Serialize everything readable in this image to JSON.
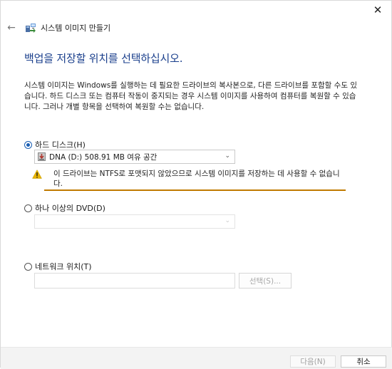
{
  "window": {
    "close_glyph": "✕",
    "back_glyph": "←",
    "title": "시스템 이미지 만들기"
  },
  "main": {
    "heading": "백업을 저장할 위치를 선택하십시오.",
    "description": "시스템 이미지는 Windows를 실행하는 데 필요한 드라이브의 복사본으로, 다른 드라이브를 포함할 수도 있습니다. 하드 디스크 또는 컴퓨터 작동이 중지되는 경우 시스템 이미지를 사용하여 컴퓨터를 복원할 수 있습니다. 그러나 개별 항목을 선택하여 복원할 수는 없습니다."
  },
  "options": {
    "hard_disk": {
      "label": "하드 디스크(H)",
      "selected": true,
      "dropdown_value": "DNA (D:)  508.91 MB 여유 공간",
      "warning": "이 드라이브는 NTFS로 포맷되지 않았으므로 시스템 이미지를 저장하는 데 사용할 수 없습니다."
    },
    "dvd": {
      "label": "하나 이상의 DVD(D)",
      "selected": false,
      "dropdown_value": ""
    },
    "network": {
      "label": "네트워크 위치(T)",
      "selected": false,
      "path_value": "",
      "select_button": "선택(S)..."
    }
  },
  "footer": {
    "next_label": "다음(N)",
    "cancel_label": "취소"
  },
  "colors": {
    "heading": "#1a3f8c",
    "accent": "#1a5fb4",
    "warning": "#e8b400",
    "warning_line": "#c07a00"
  }
}
